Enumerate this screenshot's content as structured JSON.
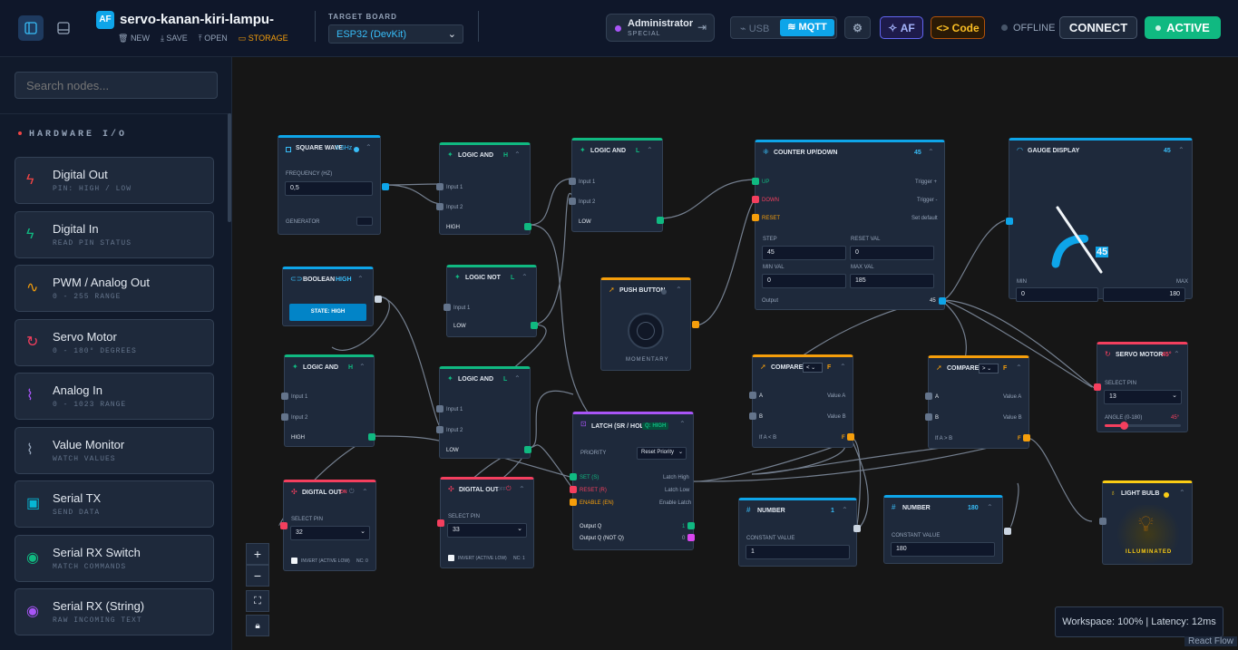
{
  "app": {
    "logo": "AF",
    "project_name": "servo-kanan-kiri-lampu-",
    "actions": {
      "new": "NEW",
      "save": "SAVE",
      "open": "OPEN",
      "storage": "STORAGE"
    }
  },
  "board": {
    "label": "TARGET BOARD",
    "value": "ESP32 (DevKit)"
  },
  "user": {
    "name": "Administrator",
    "role": "SPECIAL"
  },
  "transport": {
    "usb": "USB",
    "mqtt": "MQTT"
  },
  "toolbar": {
    "af": "AF",
    "code": "Code",
    "status": "OFFLINE",
    "connect": "CONNECT",
    "active": "ACTIVE"
  },
  "sidebar": {
    "search_placeholder": "Search nodes...",
    "section": "HARDWARE I/O",
    "items": [
      {
        "title": "Digital Out",
        "sub": "PIN: HIGH / LOW",
        "icon": "bolt-icon",
        "color": "#ef4444"
      },
      {
        "title": "Digital In",
        "sub": "READ PIN STATUS",
        "icon": "bolt-icon",
        "color": "#10b981"
      },
      {
        "title": "PWM / Analog Out",
        "sub": "0 - 255 RANGE",
        "icon": "wave-icon",
        "color": "#f59e0b"
      },
      {
        "title": "Servo Motor",
        "sub": "0 - 180° DEGREES",
        "icon": "rotate-icon",
        "color": "#f43f5e"
      },
      {
        "title": "Analog In",
        "sub": "0 - 1023 RANGE",
        "icon": "pulse-icon",
        "color": "#a855f7"
      },
      {
        "title": "Value Monitor",
        "sub": "WATCH VALUES",
        "icon": "pulse-icon",
        "color": "#94a3b8"
      },
      {
        "title": "Serial TX",
        "sub": "SEND DATA",
        "icon": "chip-icon",
        "color": "#06b6d4"
      },
      {
        "title": "Serial RX Switch",
        "sub": "MATCH COMMANDS",
        "icon": "radio-icon",
        "color": "#10b981"
      },
      {
        "title": "Serial RX (String)",
        "sub": "RAW INCOMING TEXT",
        "icon": "radio-icon",
        "color": "#a855f7"
      }
    ]
  },
  "nodes": {
    "square": {
      "title": "SQUARE WAVE",
      "badge": "0.5Hz",
      "freq_label": "FREQUENCY (HZ)",
      "freq": "0,5",
      "footer": "GENERATOR"
    },
    "and1": {
      "title": "LOGIC AND",
      "value": "H",
      "in1": "Input 1",
      "in2": "Input 2",
      "out": "HIGH"
    },
    "and2": {
      "title": "LOGIC AND",
      "value": "L",
      "in1": "Input 1",
      "in2": "Input 2",
      "out": "LOW"
    },
    "and3": {
      "title": "LOGIC AND",
      "value": "H",
      "in1": "Input 1",
      "in2": "Input 2",
      "out": "HIGH"
    },
    "and4": {
      "title": "LOGIC AND",
      "value": "L",
      "in1": "Input 1",
      "in2": "Input 2",
      "out": "LOW"
    },
    "bool": {
      "title": "BOOLEAN",
      "value": "HIGH",
      "button": "STATE: HIGH"
    },
    "not": {
      "title": "LOGIC NOT",
      "value": "L",
      "in1": "Input 1",
      "out": "LOW"
    },
    "push": {
      "title": "PUSH BUTTON",
      "footer": "MOMENTARY"
    },
    "counter": {
      "title": "COUNTER UP/DOWN",
      "value": "45",
      "up": "UP",
      "down": "DOWN",
      "reset": "RESET",
      "trig1": "Trigger +",
      "trig2": "Trigger -",
      "setdef": "Set default",
      "step_l": "STEP",
      "step": "45",
      "rv_l": "RESET VAL",
      "rv": "0",
      "min_l": "MIN VAL",
      "min": "0",
      "max_l": "MAX VAL",
      "max": "185",
      "out_l": "Output",
      "out": "45"
    },
    "gauge": {
      "title": "GAUGE DISPLAY",
      "value": "45",
      "reading": "45",
      "level": 0.243,
      "min_l": "MIN",
      "min": "0",
      "max_l": "MAX",
      "max": "180"
    },
    "latch": {
      "title": "LATCH (SR / HOLD)",
      "badge": "Q: HIGH",
      "prio_l": "PRIORITY",
      "prio": "Reset Priority",
      "set": "SET (S)",
      "set_r": "Latch High",
      "reset": "RESET (R)",
      "reset_r": "Latch Low",
      "enable": "ENABLE (EN)",
      "enable_r": "Enable Latch",
      "oq": "Output Q",
      "oqv": "1",
      "oqn": "Output Q (NOT Q)",
      "oqnv": "0"
    },
    "cmp1": {
      "title": "COMPARE",
      "op": "<",
      "value": "F",
      "a": "A",
      "b": "B",
      "va": "Value A",
      "vb": "Value B",
      "expr": "If A < B",
      "out": "F"
    },
    "cmp2": {
      "title": "COMPARE",
      "op": ">",
      "value": "F",
      "a": "A",
      "b": "B",
      "va": "Value A",
      "vb": "Value B",
      "expr": "If A > B",
      "out": "F"
    },
    "servo": {
      "title": "SERVO MOTOR",
      "value": "45°",
      "pin_l": "SELECT PIN",
      "pin": "13",
      "angle_l": "ANGLE (0-180)",
      "angle": "45°",
      "angle_frac": 0.25
    },
    "dout1": {
      "title": "DIGITAL OUT",
      "badge": "ON",
      "pin_l": "SELECT PIN",
      "pin": "32",
      "invert": "INVERT (ACTIVE LOW)",
      "invert_r": "NC: 0"
    },
    "dout2": {
      "title": "DIGITAL OUT",
      "badge": "OFF",
      "pin_l": "SELECT PIN",
      "pin": "33",
      "invert": "INVERT (ACTIVE LOW)",
      "invert_r": "NC: 1"
    },
    "num1": {
      "title": "NUMBER",
      "value": "1",
      "cv_l": "CONSTANT VALUE",
      "cv": "1"
    },
    "num2": {
      "title": "NUMBER",
      "value": "180",
      "cv_l": "CONSTANT VALUE",
      "cv": "180"
    },
    "bulb": {
      "title": "LIGHT BULB",
      "state": "ILLUMINATED"
    }
  },
  "footer": {
    "status": "Workspace: 100% | Latency: 12ms",
    "attribution": "React Flow"
  },
  "colors": {
    "accent": "#0ea5e9",
    "active": "#10b981",
    "bg": "#0b1220"
  }
}
